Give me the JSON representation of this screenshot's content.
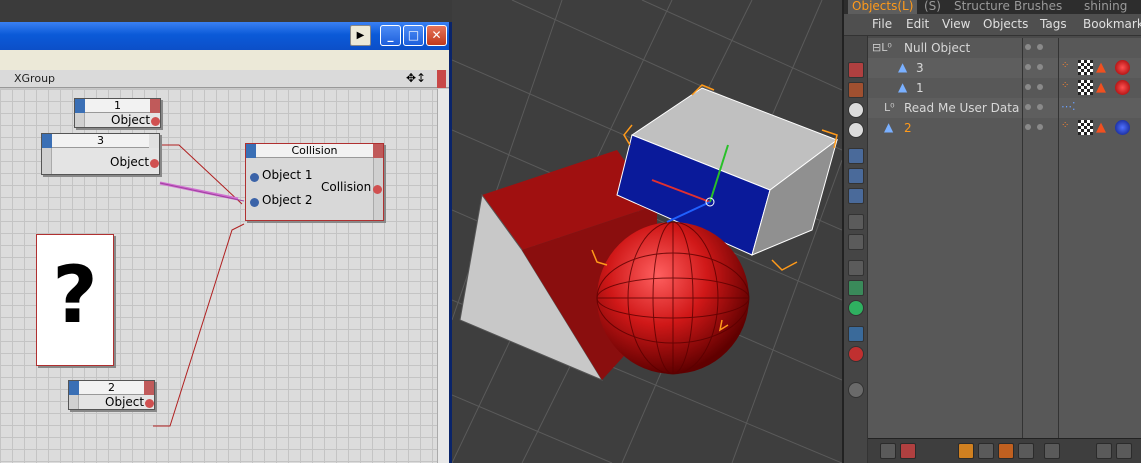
{
  "xpresso": {
    "window_buttons": {
      "play": "▶",
      "minimize": "_",
      "maximize": "□",
      "close": "✕"
    },
    "group_title": "XGroup",
    "nodes": {
      "obj1": {
        "title": "1",
        "port": "Object"
      },
      "obj3": {
        "title": "3",
        "port": "Object"
      },
      "obj2": {
        "title": "2",
        "port": "Object"
      },
      "collision": {
        "title": "Collision",
        "in1": "Object 1",
        "in2": "Object 2",
        "out": "Collision"
      }
    },
    "question_card": "?"
  },
  "object_manager": {
    "tabs": [
      "Objects(L)",
      "(S)",
      "Structure",
      "Brushes",
      "shining"
    ],
    "active_tab": "Objects(L)",
    "menu": [
      "File",
      "Edit",
      "View",
      "Objects",
      "Tags",
      "Bookmarks"
    ],
    "objects": [
      {
        "name": "Null Object",
        "level": 0,
        "selected": false
      },
      {
        "name": "3",
        "level": 1,
        "selected": false
      },
      {
        "name": "1",
        "level": 1,
        "selected": false
      },
      {
        "name": "Read Me User Data",
        "level": 0,
        "selected": false
      },
      {
        "name": "2",
        "level": 0,
        "selected": true
      }
    ]
  },
  "colors": {
    "accent_orange": "#ff9a1a",
    "xp_title_blue": "#0b5ad8",
    "cube_blue": "#0a1a9a",
    "cube_red": "#a01010",
    "sphere_red": "#d01818",
    "sphere_blue_tag": "#1030c0"
  }
}
